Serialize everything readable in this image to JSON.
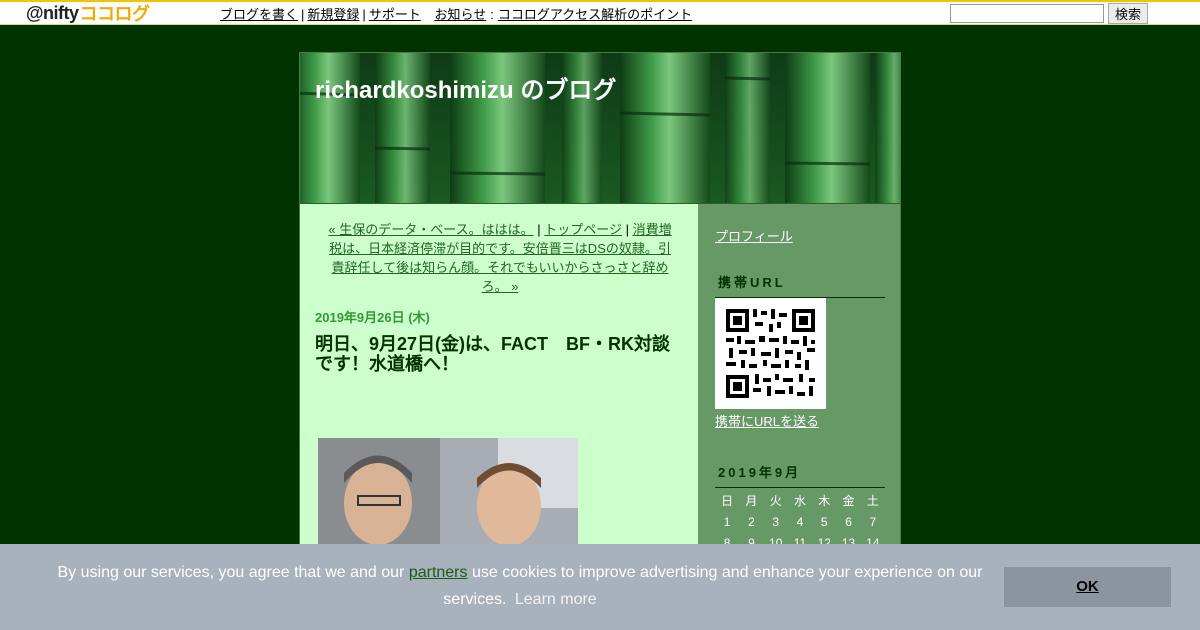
{
  "topbar": {
    "logo_at": "@nifty",
    "logo_coco": "ココログ",
    "links": [
      "ブログを書く",
      "新規登録",
      "サポート",
      "お知らせ"
    ],
    "notice_text": "ココログアクセス解析のポイント",
    "search_button": "検索",
    "search_value": ""
  },
  "blog": {
    "title": "richardkoshimizu のブログ"
  },
  "postnav": {
    "prev": "« 生保のデータ・ベース。ははは。",
    "top": "トップページ",
    "next": "消費増税は、日本経済停滞が目的です。安倍晋三はDSの奴隷。引責辞任して後は知らん顔。それでもいいからさっさと辞めろ。 »"
  },
  "post": {
    "date": "2019年9月26日 (木)",
    "title": "明日、9月27日(金)は、FACT　BF・RK対談です！水道橋へ！"
  },
  "sidebar": {
    "profile_link": "プロフィール",
    "mobile_heading": "携帯URL",
    "send_url_link": "携帯にURLを送る",
    "calendar_heading": "2019年9月",
    "weekdays": [
      "日",
      "月",
      "火",
      "水",
      "木",
      "金",
      "土"
    ],
    "weeks": [
      [
        "1",
        "2",
        "3",
        "4",
        "5",
        "6",
        "7"
      ],
      [
        "8",
        "9",
        "10",
        "11",
        "12",
        "13",
        "14"
      ]
    ]
  },
  "cookie": {
    "text_before": "By using our services, you agree that we and our",
    "partners_link": "partners",
    "text_after": "use cookies to improve advertising and enhance your experience on our services.",
    "learn_more": "Learn more",
    "ok_label": "OK"
  },
  "colors": {
    "page_bg": "#003300",
    "main_bg": "#ccffcc",
    "sidebar_bg": "#669966",
    "date_color": "#339933",
    "cookie_bg": "#a8b2bc"
  }
}
